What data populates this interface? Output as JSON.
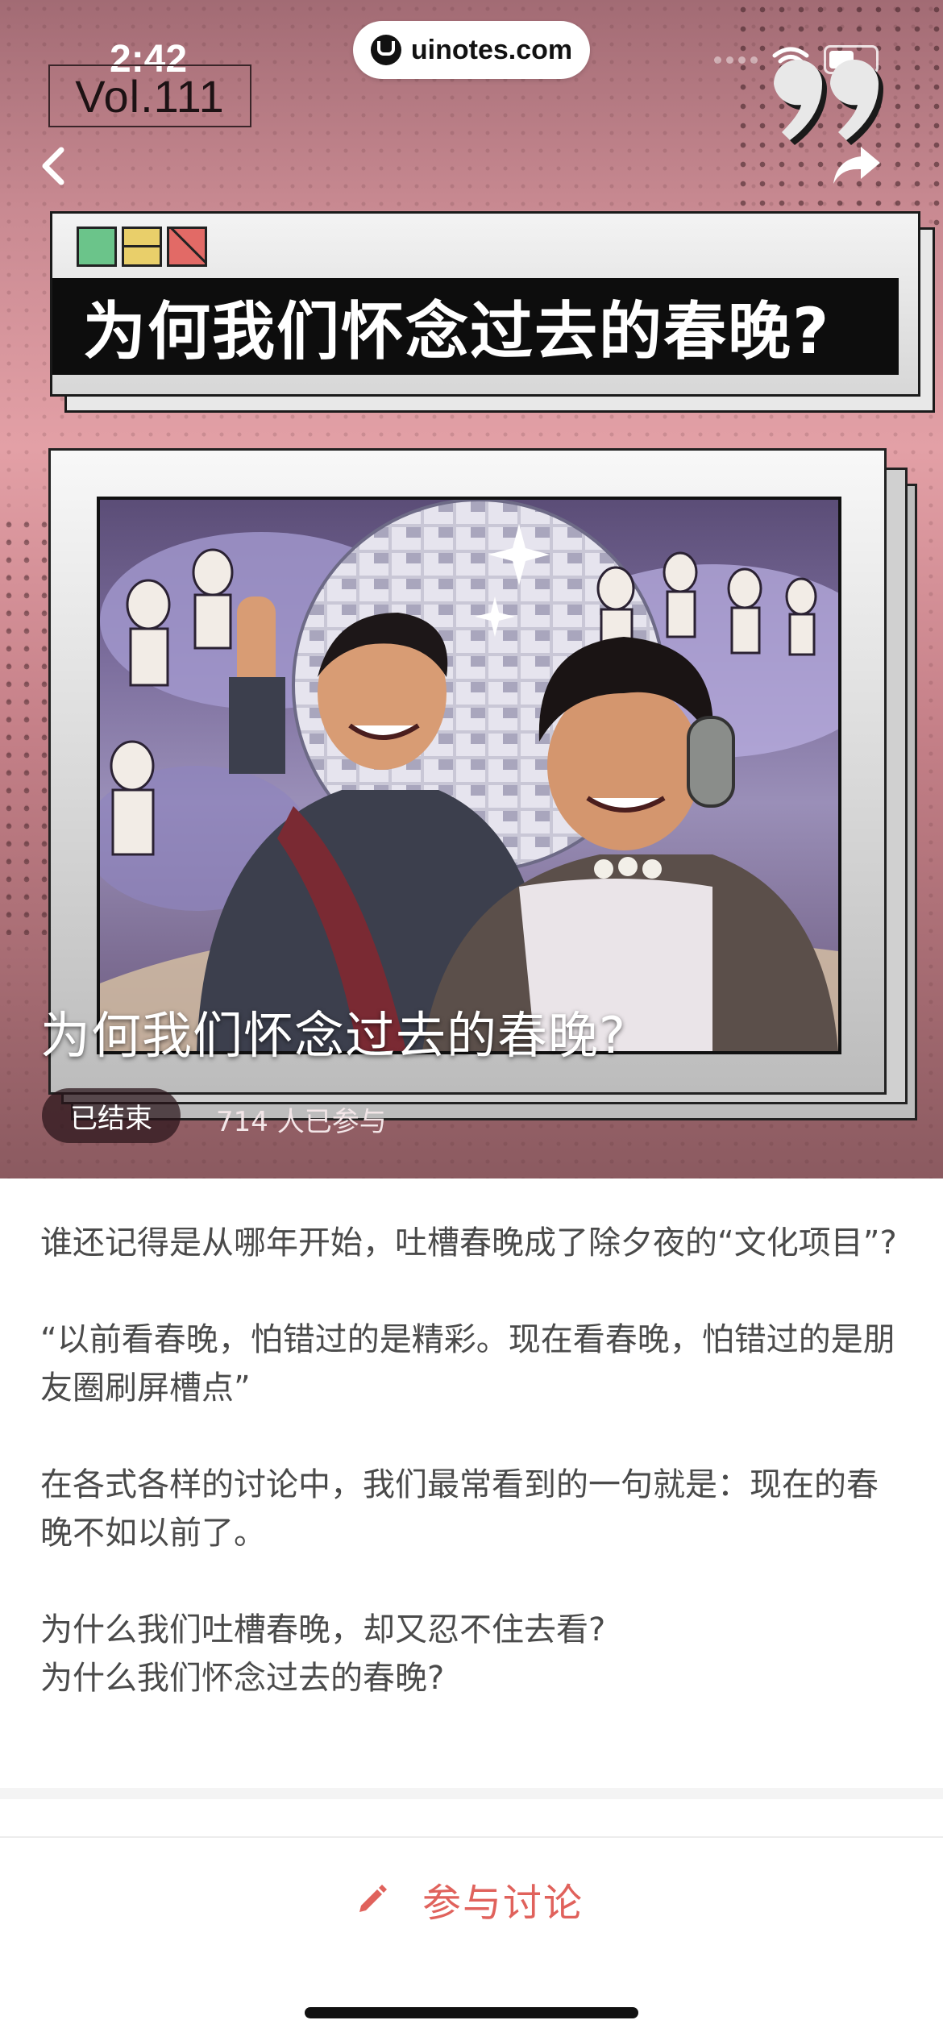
{
  "status_bar": {
    "time": "2:42"
  },
  "browser": {
    "url": "uinotes.com"
  },
  "header": {
    "volume": "Vol.111"
  },
  "banner": {
    "title": "为何我们怀念过去的春晚?"
  },
  "topic": {
    "title": "为何我们怀念过去的春晚?",
    "status": "已结束",
    "participants": "714 人已参与"
  },
  "body": {
    "paragraphs": [
      "谁还记得是从哪年开始，吐槽春晚成了除夕夜的“文化项目”?",
      "“以前看春晚，怕错过的是精彩。现在看春晚，怕错过的是朋友圈刷屏槽点”",
      "在各式各样的讨论中，我们最常看到的一句就是：现在的春晚不如以前了。"
    ],
    "questions": [
      "为什么我们吐槽春晚，却又忍不住去看?",
      "为什么我们怀念过去的春晚?"
    ]
  },
  "footer": {
    "discuss_label": "参与讨论"
  },
  "colors": {
    "accent": "#e0625c",
    "hero_pink": "#e3a0a6",
    "text": "#4a4a4a"
  },
  "icons": [
    "back-icon",
    "share-icon",
    "quote-icon",
    "pencil-icon",
    "wifi-icon",
    "battery-icon"
  ]
}
